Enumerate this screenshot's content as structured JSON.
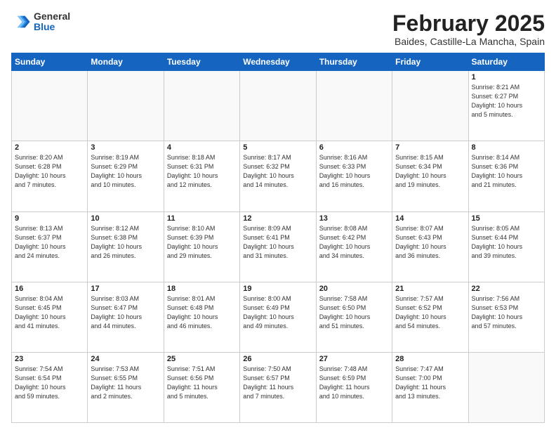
{
  "logo": {
    "general": "General",
    "blue": "Blue"
  },
  "header": {
    "month": "February 2025",
    "location": "Baides, Castille-La Mancha, Spain"
  },
  "weekdays": [
    "Sunday",
    "Monday",
    "Tuesday",
    "Wednesday",
    "Thursday",
    "Friday",
    "Saturday"
  ],
  "weeks": [
    [
      {
        "day": "",
        "info": ""
      },
      {
        "day": "",
        "info": ""
      },
      {
        "day": "",
        "info": ""
      },
      {
        "day": "",
        "info": ""
      },
      {
        "day": "",
        "info": ""
      },
      {
        "day": "",
        "info": ""
      },
      {
        "day": "1",
        "info": "Sunrise: 8:21 AM\nSunset: 6:27 PM\nDaylight: 10 hours\nand 5 minutes."
      }
    ],
    [
      {
        "day": "2",
        "info": "Sunrise: 8:20 AM\nSunset: 6:28 PM\nDaylight: 10 hours\nand 7 minutes."
      },
      {
        "day": "3",
        "info": "Sunrise: 8:19 AM\nSunset: 6:29 PM\nDaylight: 10 hours\nand 10 minutes."
      },
      {
        "day": "4",
        "info": "Sunrise: 8:18 AM\nSunset: 6:31 PM\nDaylight: 10 hours\nand 12 minutes."
      },
      {
        "day": "5",
        "info": "Sunrise: 8:17 AM\nSunset: 6:32 PM\nDaylight: 10 hours\nand 14 minutes."
      },
      {
        "day": "6",
        "info": "Sunrise: 8:16 AM\nSunset: 6:33 PM\nDaylight: 10 hours\nand 16 minutes."
      },
      {
        "day": "7",
        "info": "Sunrise: 8:15 AM\nSunset: 6:34 PM\nDaylight: 10 hours\nand 19 minutes."
      },
      {
        "day": "8",
        "info": "Sunrise: 8:14 AM\nSunset: 6:36 PM\nDaylight: 10 hours\nand 21 minutes."
      }
    ],
    [
      {
        "day": "9",
        "info": "Sunrise: 8:13 AM\nSunset: 6:37 PM\nDaylight: 10 hours\nand 24 minutes."
      },
      {
        "day": "10",
        "info": "Sunrise: 8:12 AM\nSunset: 6:38 PM\nDaylight: 10 hours\nand 26 minutes."
      },
      {
        "day": "11",
        "info": "Sunrise: 8:10 AM\nSunset: 6:39 PM\nDaylight: 10 hours\nand 29 minutes."
      },
      {
        "day": "12",
        "info": "Sunrise: 8:09 AM\nSunset: 6:41 PM\nDaylight: 10 hours\nand 31 minutes."
      },
      {
        "day": "13",
        "info": "Sunrise: 8:08 AM\nSunset: 6:42 PM\nDaylight: 10 hours\nand 34 minutes."
      },
      {
        "day": "14",
        "info": "Sunrise: 8:07 AM\nSunset: 6:43 PM\nDaylight: 10 hours\nand 36 minutes."
      },
      {
        "day": "15",
        "info": "Sunrise: 8:05 AM\nSunset: 6:44 PM\nDaylight: 10 hours\nand 39 minutes."
      }
    ],
    [
      {
        "day": "16",
        "info": "Sunrise: 8:04 AM\nSunset: 6:45 PM\nDaylight: 10 hours\nand 41 minutes."
      },
      {
        "day": "17",
        "info": "Sunrise: 8:03 AM\nSunset: 6:47 PM\nDaylight: 10 hours\nand 44 minutes."
      },
      {
        "day": "18",
        "info": "Sunrise: 8:01 AM\nSunset: 6:48 PM\nDaylight: 10 hours\nand 46 minutes."
      },
      {
        "day": "19",
        "info": "Sunrise: 8:00 AM\nSunset: 6:49 PM\nDaylight: 10 hours\nand 49 minutes."
      },
      {
        "day": "20",
        "info": "Sunrise: 7:58 AM\nSunset: 6:50 PM\nDaylight: 10 hours\nand 51 minutes."
      },
      {
        "day": "21",
        "info": "Sunrise: 7:57 AM\nSunset: 6:52 PM\nDaylight: 10 hours\nand 54 minutes."
      },
      {
        "day": "22",
        "info": "Sunrise: 7:56 AM\nSunset: 6:53 PM\nDaylight: 10 hours\nand 57 minutes."
      }
    ],
    [
      {
        "day": "23",
        "info": "Sunrise: 7:54 AM\nSunset: 6:54 PM\nDaylight: 10 hours\nand 59 minutes."
      },
      {
        "day": "24",
        "info": "Sunrise: 7:53 AM\nSunset: 6:55 PM\nDaylight: 11 hours\nand 2 minutes."
      },
      {
        "day": "25",
        "info": "Sunrise: 7:51 AM\nSunset: 6:56 PM\nDaylight: 11 hours\nand 5 minutes."
      },
      {
        "day": "26",
        "info": "Sunrise: 7:50 AM\nSunset: 6:57 PM\nDaylight: 11 hours\nand 7 minutes."
      },
      {
        "day": "27",
        "info": "Sunrise: 7:48 AM\nSunset: 6:59 PM\nDaylight: 11 hours\nand 10 minutes."
      },
      {
        "day": "28",
        "info": "Sunrise: 7:47 AM\nSunset: 7:00 PM\nDaylight: 11 hours\nand 13 minutes."
      },
      {
        "day": "",
        "info": ""
      }
    ]
  ]
}
